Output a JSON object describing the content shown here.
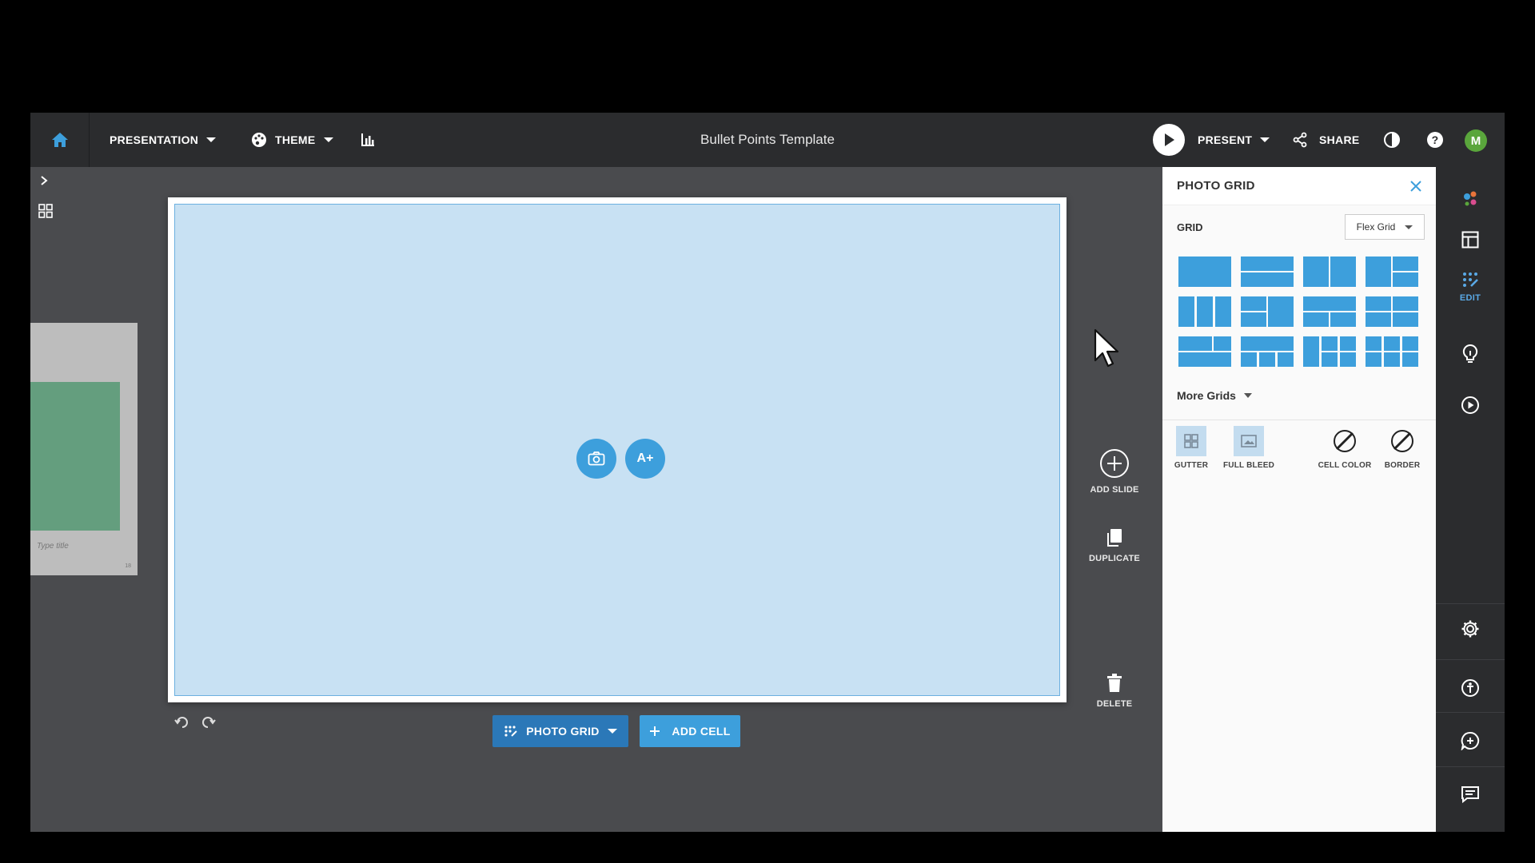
{
  "topbar": {
    "presentation_label": "PRESENTATION",
    "theme_label": "THEME",
    "doc_title": "Bullet Points Template",
    "present_label": "PRESENT",
    "share_label": "SHARE",
    "avatar_initial": "M"
  },
  "thumbnail": {
    "title_placeholder": "Type title",
    "number": "18"
  },
  "slide": {
    "add_image_icon": "camera-icon",
    "add_text_label": "A+"
  },
  "bottom_bar": {
    "photo_grid_label": "PHOTO GRID",
    "add_cell_label": "ADD CELL"
  },
  "side_actions": {
    "add_slide": "ADD SLIDE",
    "duplicate": "DUPLICATE",
    "delete": "DELETE"
  },
  "panel": {
    "title": "PHOTO GRID",
    "grid_label": "GRID",
    "grid_type": "Flex Grid",
    "more_grids": "More Grids",
    "options": {
      "gutter": "GUTTER",
      "full_bleed": "FULL BLEED",
      "cell_color": "CELL COLOR",
      "border": "BORDER"
    }
  },
  "rail": {
    "edit_label": "EDIT"
  },
  "colors": {
    "accent": "#3d9fdc",
    "topbar": "#2b2c2e",
    "workspace": "#4a4b4e",
    "cell_fill": "#c8e1f3",
    "avatar": "#5aa63c"
  }
}
